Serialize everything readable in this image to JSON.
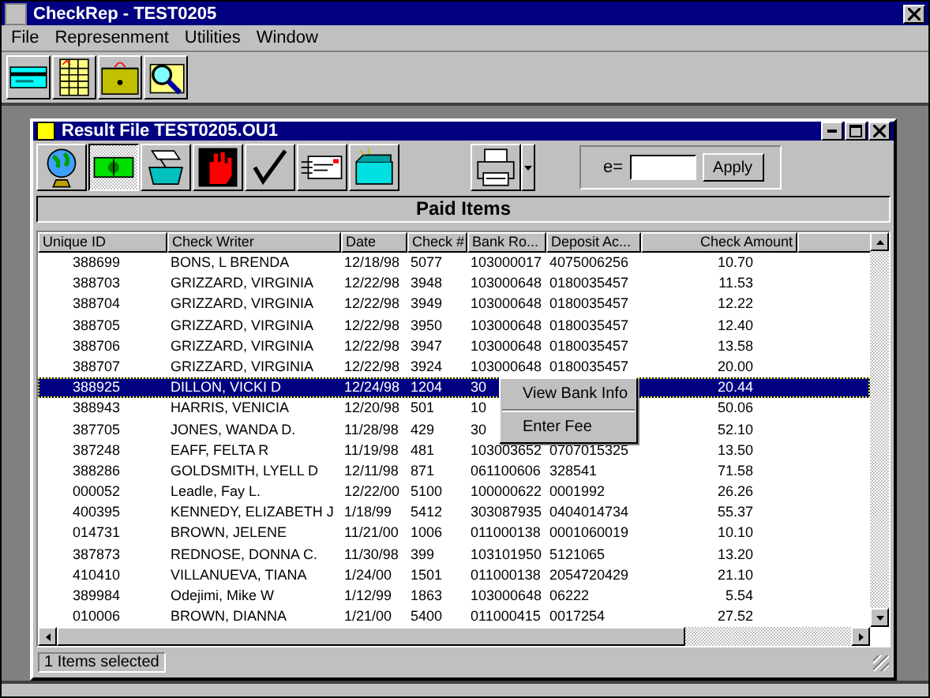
{
  "window": {
    "title": "CheckRep - TEST0205"
  },
  "menu": [
    "File",
    "Represenment",
    "Utilities",
    "Window"
  ],
  "main_toolbar": [
    {
      "kind": "card"
    },
    {
      "kind": "ledger"
    },
    {
      "kind": "cashbox"
    },
    {
      "kind": "search"
    }
  ],
  "child_window": {
    "title": "Result File TEST0205.OU1"
  },
  "child_toolbar": [
    {
      "kind": "globe",
      "selected": false
    },
    {
      "kind": "money",
      "selected": true
    },
    {
      "kind": "handbox",
      "selected": false
    },
    {
      "kind": "stop",
      "selected": false
    },
    {
      "kind": "check",
      "selected": false
    },
    {
      "kind": "form",
      "selected": false
    },
    {
      "kind": "box",
      "selected": false
    }
  ],
  "filter": {
    "label": "e=",
    "button": "Apply"
  },
  "heading": "Paid Items",
  "table": {
    "columns": [
      "Unique ID",
      "Check Writer",
      "Date",
      "Check #",
      "Bank Ro...",
      "Deposit Ac...",
      "Check Amount"
    ],
    "rows": [
      {
        "cells": [
          "388699",
          "BONS, L BRENDA",
          "12/18/98",
          "5077",
          "103000017",
          "4075006256",
          "10.70"
        ],
        "selected": false
      },
      {
        "cells": [
          "388703",
          "GRIZZARD, VIRGINIA",
          "12/22/98",
          "3948",
          "103000648",
          "0180035457",
          "11.53"
        ],
        "selected": false
      },
      {
        "cells": [
          "388704",
          "GRIZZARD, VIRGINIA",
          "12/22/98",
          "3949",
          "103000648",
          "0180035457",
          "12.22"
        ],
        "selected": false
      },
      {
        "cells": [
          "388705",
          "GRIZZARD, VIRGINIA",
          "12/22/98",
          "3950",
          "103000648",
          "0180035457",
          "12.40"
        ],
        "selected": false
      },
      {
        "cells": [
          "388706",
          "GRIZZARD, VIRGINIA",
          "12/22/98",
          "3947",
          "103000648",
          "0180035457",
          "13.58"
        ],
        "selected": false
      },
      {
        "cells": [
          "388707",
          "GRIZZARD, VIRGINIA",
          "12/22/98",
          "3924",
          "103000648",
          "0180035457",
          "20.00"
        ],
        "selected": false
      },
      {
        "cells": [
          "388925",
          "DILLON, VICKI D",
          "12/24/98",
          "1204",
          "30",
          null,
          "20.44"
        ],
        "selected": true
      },
      {
        "cells": [
          "388943",
          "HARRIS, VENICIA",
          "12/20/98",
          "501",
          "10",
          null,
          "50.06"
        ],
        "selected": false
      },
      {
        "cells": [
          "387705",
          "JONES, WANDA D.",
          "11/28/98",
          "429",
          "30",
          null,
          "52.10"
        ],
        "selected": false
      },
      {
        "cells": [
          "387248",
          "EAFF, FELTA R",
          "11/19/98",
          "481",
          "103003652",
          "0707015325",
          "13.50"
        ],
        "selected": false
      },
      {
        "cells": [
          "388286",
          "GOLDSMITH, LYELL D",
          "12/11/98",
          "871",
          "061100606",
          "328541",
          "71.58"
        ],
        "selected": false
      },
      {
        "cells": [
          "000052",
          "Leadle, Fay L.",
          "12/22/00",
          "5100",
          "100000622",
          "0001992",
          "26.26"
        ],
        "selected": false
      },
      {
        "cells": [
          "400395",
          "KENNEDY, ELIZABETH J",
          "1/18/99",
          "5412",
          "303087935",
          "0404014734",
          "55.37"
        ],
        "selected": false
      },
      {
        "cells": [
          "014731",
          "BROWN, JELENE",
          "11/21/00",
          "1006",
          "011000138",
          "0001060019",
          "10.10"
        ],
        "selected": false
      },
      {
        "cells": [
          "387873",
          "REDNOSE, DONNA C.",
          "11/30/98",
          "399",
          "103101950",
          "5121065",
          "13.20"
        ],
        "selected": false
      },
      {
        "cells": [
          "410410",
          "VILLANUEVA, TIANA",
          "1/24/00",
          "1501",
          "011000138",
          "2054720429",
          "21.10"
        ],
        "selected": false
      },
      {
        "cells": [
          "389984",
          "Odejimi, Mike W",
          "1/12/99",
          "1863",
          "103000648",
          "06222",
          "5.54"
        ],
        "selected": false
      },
      {
        "cells": [
          "010006",
          "BROWN, DIANNA",
          "1/21/00",
          "5400",
          "011000415",
          "0017254",
          "27.52"
        ],
        "selected": false
      }
    ]
  },
  "context_menu": [
    "View Bank Info",
    "Enter Fee"
  ],
  "status_bar": "1 Items selected"
}
